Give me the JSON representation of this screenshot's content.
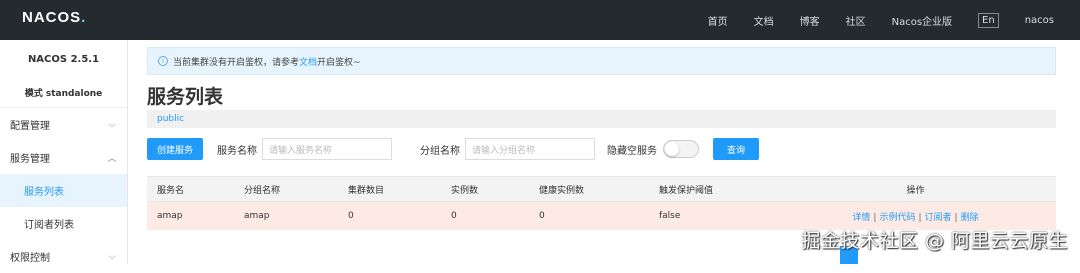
{
  "topbar": {
    "logo": "NACOS",
    "nav": [
      "首页",
      "文档",
      "博客",
      "社区",
      "Nacos企业版"
    ],
    "lang": "En",
    "user": "nacos"
  },
  "sidebar": {
    "version": "NACOS 2.5.1",
    "mode": "模式 standalone",
    "items": [
      {
        "label": "配置管理"
      },
      {
        "label": "服务管理"
      },
      {
        "label": "服务列表",
        "active": true
      },
      {
        "label": "订阅者列表"
      },
      {
        "label": "权限控制"
      }
    ]
  },
  "notice": {
    "prefix": "当前集群没有开启鉴权，请参考",
    "link": "文档",
    "suffix": "开启鉴权~"
  },
  "page": {
    "title": "服务列表",
    "namespace": "public"
  },
  "filters": {
    "create_button": "创建服务",
    "service_name_label": "服务名称",
    "service_name_placeholder": "请输入服务名称",
    "group_name_label": "分组名称",
    "group_name_placeholder": "请输入分组名称",
    "hide_empty_label": "隐藏空服务",
    "query_button": "查询"
  },
  "table": {
    "headers": [
      "服务名",
      "分组名称",
      "集群数目",
      "实例数",
      "健康实例数",
      "触发保护阈值",
      "操作"
    ],
    "rows": [
      {
        "service": "amap",
        "group": "amap",
        "clusters": "0",
        "instances": "0",
        "healthy": "0",
        "threshold": "false",
        "ops": [
          "详情",
          "示例代码",
          "订阅者",
          "删除"
        ]
      }
    ]
  },
  "watermark": "掘金技术社区 @ 阿里云云原生"
}
